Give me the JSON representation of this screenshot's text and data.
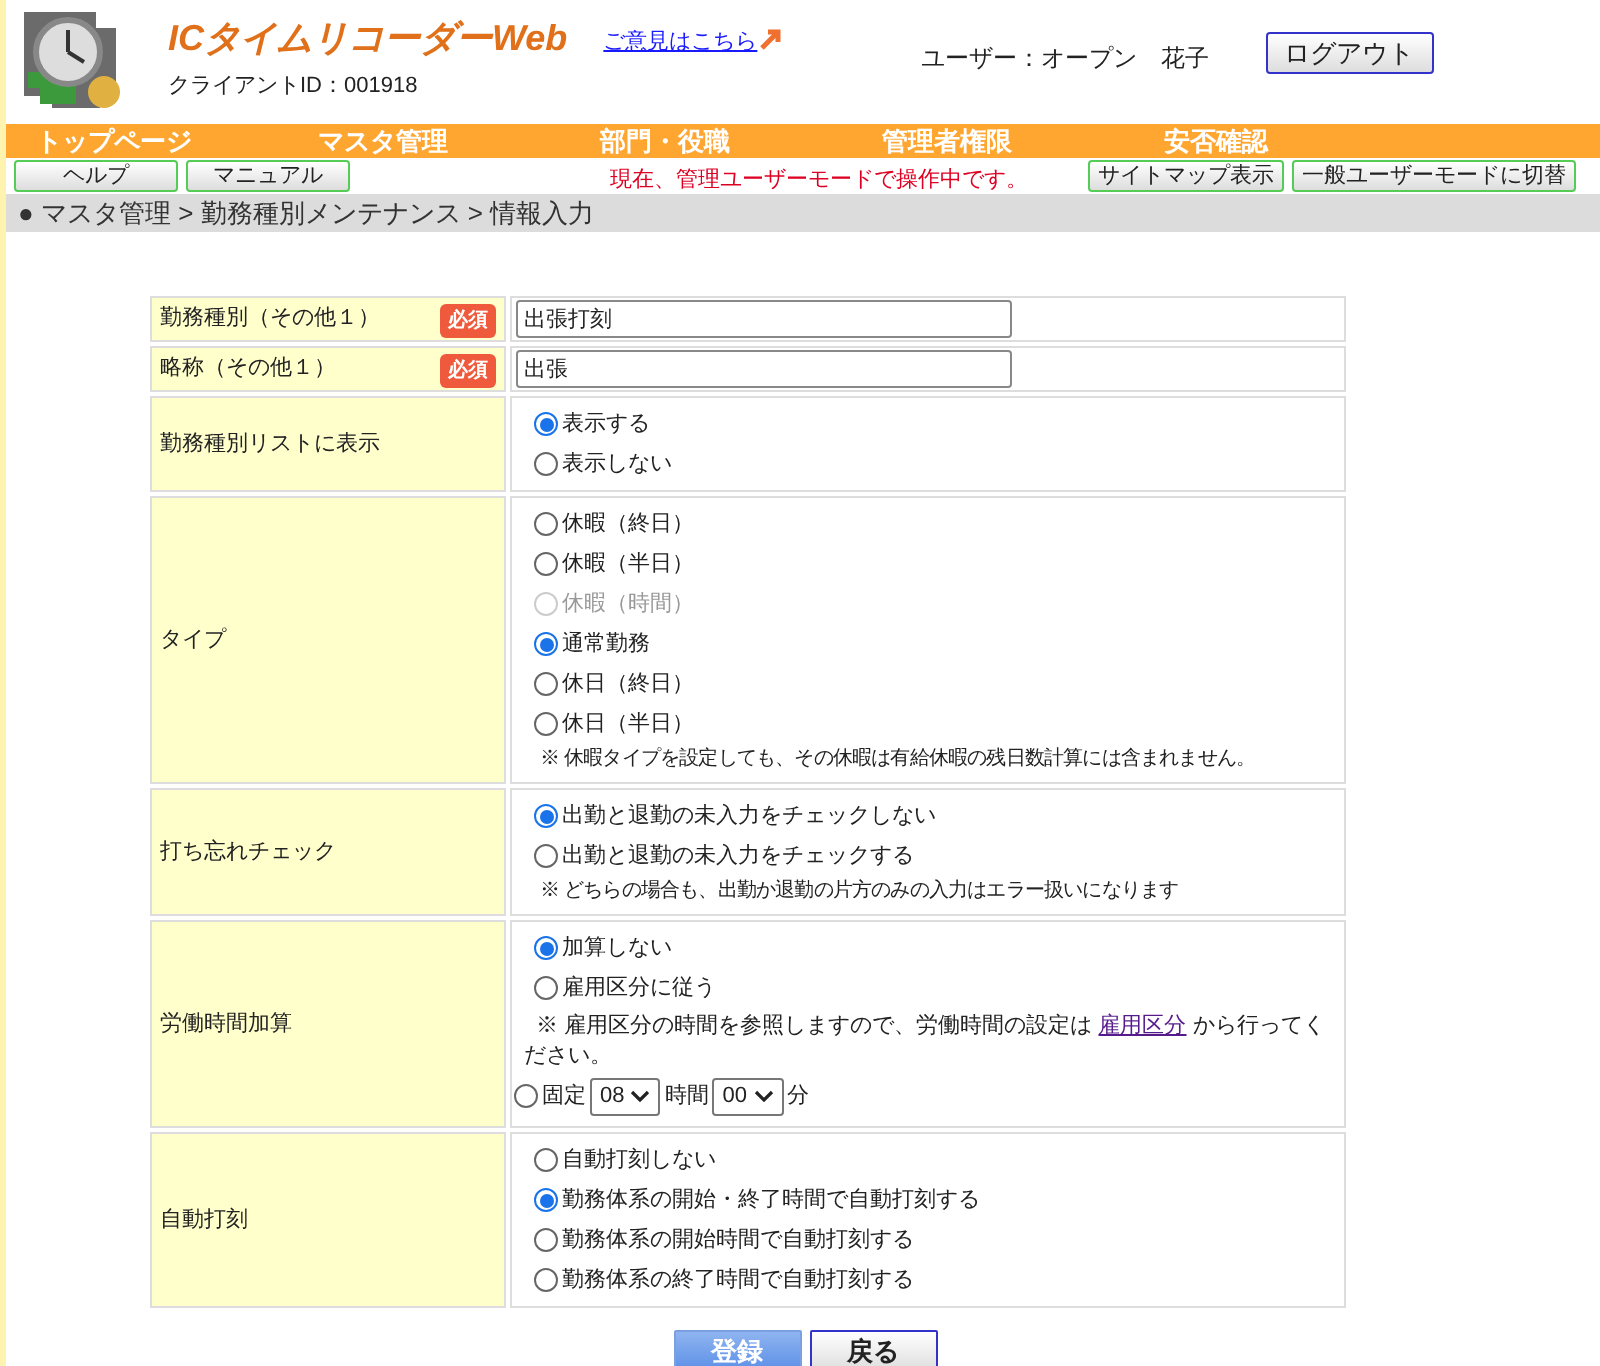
{
  "header": {
    "title": "ICタイムリコーダーWeb",
    "client_id": "クライアントID：001918",
    "feedback_link": "ご意見はこちら",
    "user": "ユーザー：オープン　花子",
    "logout": "ログアウト"
  },
  "nav": [
    "トップページ",
    "マスタ管理",
    "部門・役職",
    "管理者権限",
    "安否確認"
  ],
  "sub_left": [
    "ヘルプ",
    "マニュアル"
  ],
  "mode_notice": "現在、管理ユーザーモードで操作中です。",
  "sub_right": [
    "サイトマップ表示",
    "一般ユーザーモードに切替"
  ],
  "breadcrumb": "● マスタ管理 > 勤務種別メンテナンス > 情報入力",
  "form": [
    {
      "label": "勤務種別（その他１）",
      "required": "必須",
      "items": [
        {
          "kind": "text",
          "value": "出張打刻"
        }
      ]
    },
    {
      "label": "略称（その他１）",
      "required": "必須",
      "items": [
        {
          "kind": "text",
          "value": "出張"
        }
      ]
    },
    {
      "label": "勤務種別リストに表示",
      "items": [
        {
          "kind": "radio",
          "label": "表示する",
          "selected": true,
          "disabled": false
        },
        {
          "kind": "radio",
          "label": "表示しない",
          "selected": false,
          "disabled": false
        }
      ]
    },
    {
      "label": "タイプ",
      "items": [
        {
          "kind": "radio",
          "label": "休暇（終日）",
          "selected": false,
          "disabled": false
        },
        {
          "kind": "radio",
          "label": "休暇（半日）",
          "selected": false,
          "disabled": false
        },
        {
          "kind": "radio",
          "label": "休暇（時間）",
          "selected": false,
          "disabled": true
        },
        {
          "kind": "radio",
          "label": "通常勤務",
          "selected": true,
          "disabled": false
        },
        {
          "kind": "radio",
          "label": "休日（終日）",
          "selected": false,
          "disabled": false
        },
        {
          "kind": "radio",
          "label": "休日（半日）",
          "selected": false,
          "disabled": false
        },
        {
          "kind": "note",
          "text": "※ 休暇タイプを設定しても、その休暇は有給休暇の残日数計算には含まれません。"
        }
      ]
    },
    {
      "label": "打ち忘れチェック",
      "items": [
        {
          "kind": "radio",
          "label": "出勤と退勤の未入力をチェックしない",
          "selected": true,
          "disabled": false
        },
        {
          "kind": "radio",
          "label": "出勤と退勤の未入力をチェックする",
          "selected": false,
          "disabled": false
        },
        {
          "kind": "note",
          "text": "※ どちらの場合も、出勤か退勤の片方のみの入力はエラー扱いになります"
        }
      ]
    },
    {
      "label": "労働時間加算",
      "items": [
        {
          "kind": "radio",
          "label": "加算しない",
          "selected": true,
          "disabled": false
        },
        {
          "kind": "radio",
          "label": "雇用区分に従う",
          "selected": false,
          "disabled": false
        },
        {
          "kind": "linknote",
          "before": "※ 雇用区分の時間を参照しますので、労働時間の設定は ",
          "link": "雇用区分",
          "after": " から行ってください。"
        },
        {
          "kind": "fixed",
          "label": "固定",
          "selected": false,
          "hour": "08",
          "hour_unit": "時間",
          "minute": "00",
          "minute_unit": "分"
        }
      ]
    },
    {
      "label": "自動打刻",
      "items": [
        {
          "kind": "radio",
          "label": "自動打刻しない",
          "selected": false,
          "disabled": false
        },
        {
          "kind": "radio",
          "label": "勤務体系の開始・終了時間で自動打刻する",
          "selected": true,
          "disabled": false
        },
        {
          "kind": "radio",
          "label": "勤務体系の開始時間で自動打刻する",
          "selected": false,
          "disabled": false
        },
        {
          "kind": "radio",
          "label": "勤務体系の終了時間で自動打刻する",
          "selected": false,
          "disabled": false
        }
      ]
    }
  ],
  "buttons": [
    {
      "label": "登録",
      "kind": "primary"
    },
    {
      "label": "戻る",
      "kind": "secondary"
    }
  ]
}
